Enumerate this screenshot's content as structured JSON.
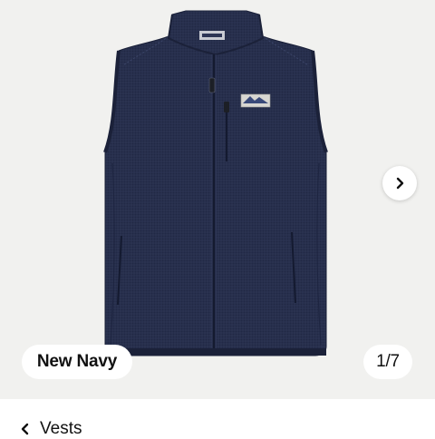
{
  "gallery": {
    "image_alt": "Navy fleece vest",
    "color_name": "New Navy",
    "counter": "1/7",
    "next_icon": "chevron-right-icon",
    "colors": {
      "background": "#f1f1ef",
      "vest": "#262e4b"
    }
  },
  "breadcrumb": {
    "back_icon": "chevron-left-icon",
    "label": "Vests"
  }
}
